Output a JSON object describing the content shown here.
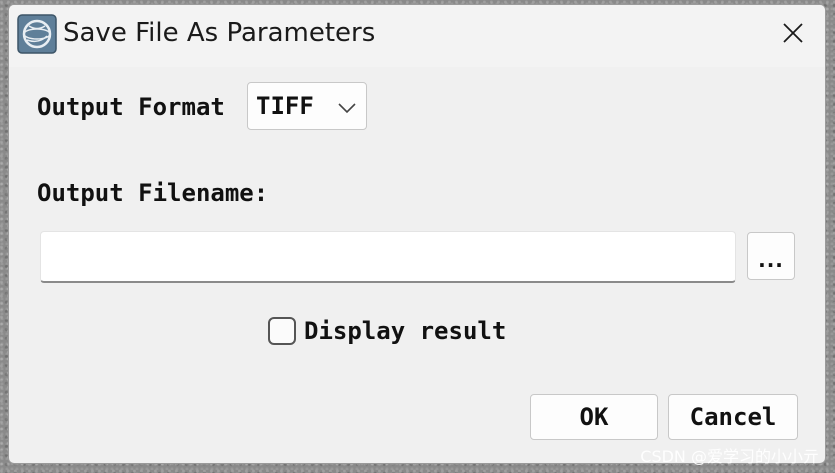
{
  "window": {
    "title": "Save File As Parameters",
    "app_icon": "envi-globe-icon",
    "close_icon": "close-icon"
  },
  "form": {
    "output_format_label": "Output Format",
    "output_format_value": "TIFF",
    "output_filename_label": "Output Filename:",
    "output_filename_value": "",
    "browse_label": "...",
    "display_result_label": "Display result",
    "display_result_checked": false
  },
  "buttons": {
    "ok_label": "OK",
    "cancel_label": "Cancel"
  },
  "watermark": "CSDN @爱学习的小小亓",
  "colors": {
    "dialog_bg": "#f0f0f0",
    "titlebar_bg": "#f3f3f3",
    "control_bg": "#fdfdfd",
    "border": "#c8c8c8"
  }
}
